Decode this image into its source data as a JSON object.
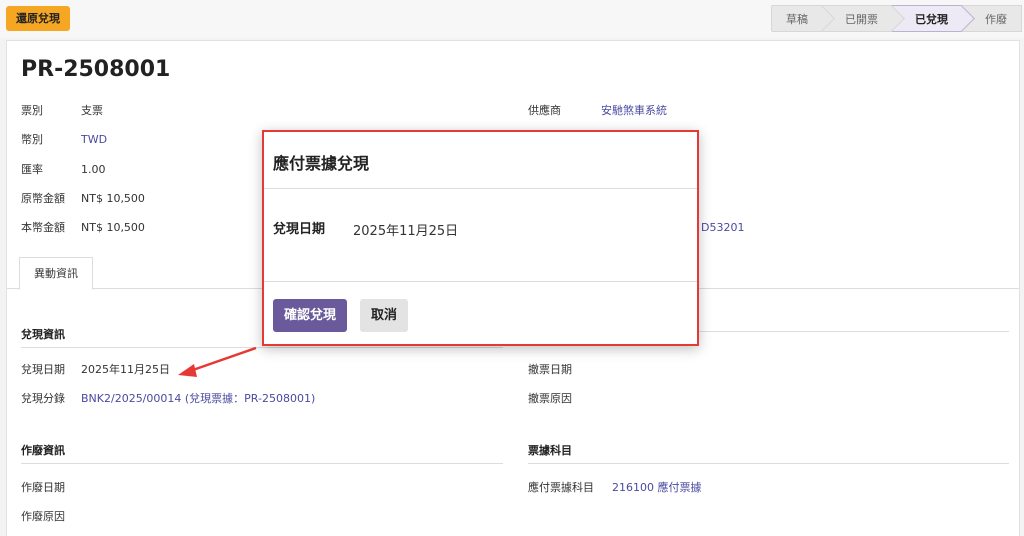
{
  "topbar": {
    "revert_label": "還原兌現"
  },
  "statusbar": [
    {
      "label": "草稿",
      "active": false
    },
    {
      "label": "已開票",
      "active": false
    },
    {
      "label": "已兌現",
      "active": true
    },
    {
      "label": "作廢",
      "active": false
    }
  ],
  "record": {
    "title": "PR-2508001",
    "fields_left": [
      {
        "label": "票別",
        "value": "支票"
      },
      {
        "label": "幣別",
        "value": "TWD"
      },
      {
        "label": "匯率",
        "value": "1.00"
      },
      {
        "label": "原幣金額",
        "value": "NT$ 10,500"
      },
      {
        "label": "本幣金額",
        "value": "NT$ 10,500"
      }
    ],
    "fields_right": [
      {
        "label": "供應商",
        "value": "安馳煞車系統"
      }
    ],
    "partial_right_value": "D53201"
  },
  "tabs": [
    {
      "label": "異動資訊"
    }
  ],
  "sections": {
    "cash": {
      "title": "兌現資訊",
      "date_label": "兌現日期",
      "date_value": "2025年11月25日",
      "journal_label": "兌現分錄",
      "journal_value": "BNK2/2025/00014 (兌現票據：PR-2508001)"
    },
    "void_fields": {
      "date_label": "撤票日期",
      "reason_label": "撤票原因"
    },
    "cancel": {
      "title": "作廢資訊",
      "date_label": "作廢日期",
      "reason_label": "作廢原因"
    },
    "account": {
      "title": "票據科目",
      "label": "應付票據科目",
      "value": "216100 應付票據"
    }
  },
  "modal": {
    "title": "應付票據兌現",
    "date_label": "兌現日期",
    "date_value": "2025年11月25日",
    "confirm_label": "確認兌現",
    "cancel_label": "取消"
  },
  "colors": {
    "primary": "#6a5a9b",
    "warning": "#f5a623",
    "highlight": "#e53935",
    "link": "#4a4aa0"
  }
}
